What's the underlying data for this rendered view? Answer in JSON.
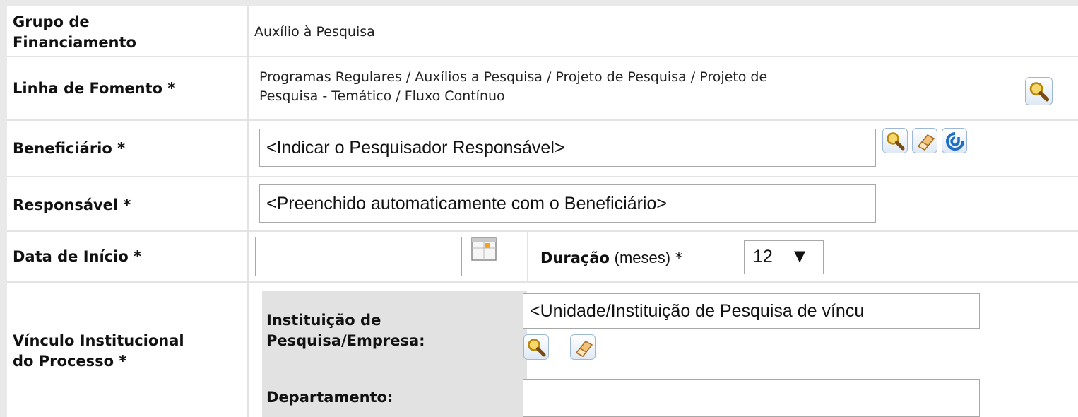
{
  "form": {
    "grupo": {
      "label_line1": "Grupo de",
      "label_line2": "Financiamento",
      "value": "Auxílio à Pesquisa"
    },
    "linha": {
      "label": "Linha de Fomento *",
      "value_line1": "Programas Regulares / Auxílios a Pesquisa / Projeto de Pesquisa / Projeto de",
      "value_line2": "Pesquisa - Temático / Fluxo Contínuo"
    },
    "beneficiario": {
      "label": "Beneficiário *",
      "value": "<Indicar o Pesquisador Responsável>"
    },
    "responsavel": {
      "label": "Responsável *",
      "value": "<Preenchido automaticamente com o Beneficiário>"
    },
    "data_inicio": {
      "label": "Data de Início *",
      "value": ""
    },
    "duracao": {
      "label_bold": "Duração",
      "label_unit": "(meses)",
      "required_mark": "*",
      "selected": "12",
      "arrow": "▼"
    },
    "vinculo": {
      "label_line1": "Vínculo Institucional",
      "label_line2": "do Processo *",
      "instituicao_label_line1": "Instituição de",
      "instituicao_label_line2": "Pesquisa/Empresa:",
      "instituicao_value": "<Unidade/Instituição de Pesquisa de víncu",
      "departamento_label": "Departamento:",
      "departamento_value": ""
    }
  },
  "icons": {
    "search": "search-icon",
    "eraser": "eraser-icon",
    "lattes": "lattes-icon",
    "calendar": "calendar-icon"
  },
  "colors": {
    "page_background": "#e9e9e9",
    "row_divider": "#e3e3e3",
    "sub_label_background": "#e2e2e2",
    "button_border": "#9cb8d6",
    "lattes_blue": "#1f6ec6"
  }
}
